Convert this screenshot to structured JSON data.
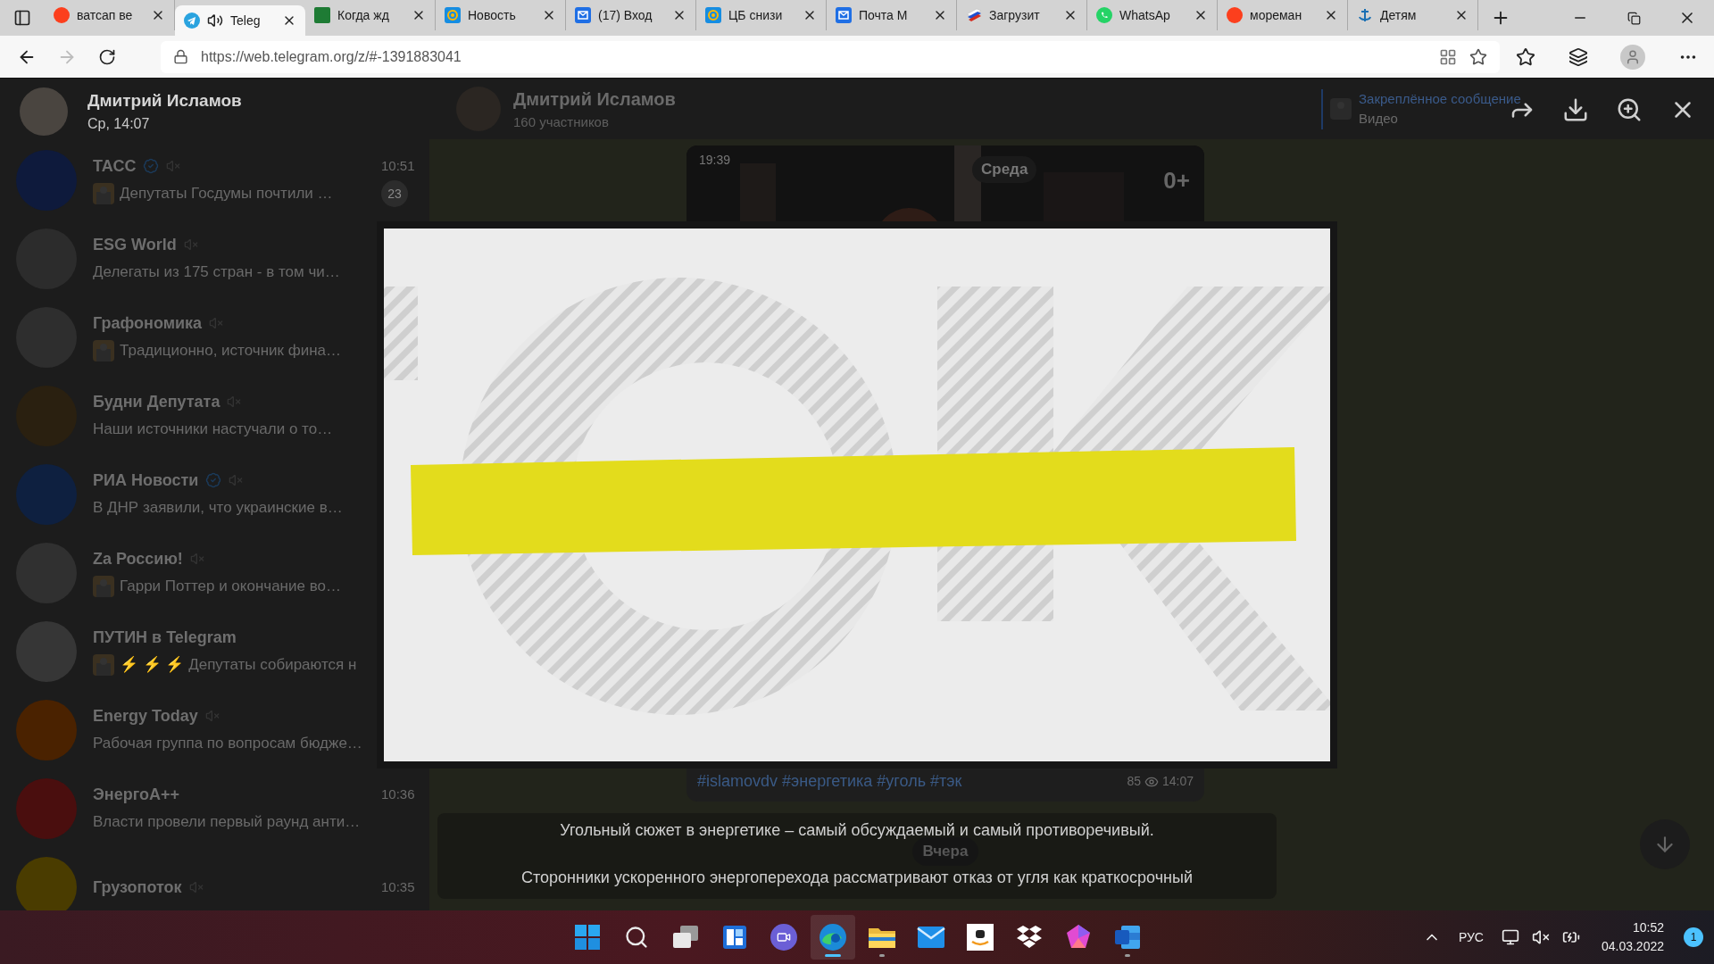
{
  "browser": {
    "tabs": [
      {
        "title": "ватсап ве",
        "kind": "yandex",
        "selected": false,
        "playing": false
      },
      {
        "title": "Teleg",
        "kind": "telegram",
        "selected": true,
        "playing": true
      },
      {
        "title": "Когда жд",
        "kind": "green",
        "selected": false,
        "playing": false
      },
      {
        "title": "Новость",
        "kind": "at",
        "selected": false,
        "playing": false
      },
      {
        "title": "(17) Вход",
        "kind": "mail",
        "selected": false,
        "playing": false
      },
      {
        "title": "ЦБ снизи",
        "kind": "at",
        "selected": false,
        "playing": false
      },
      {
        "title": "Почта М",
        "kind": "mail",
        "selected": false,
        "playing": false
      },
      {
        "title": "Загрузит",
        "kind": "flag",
        "selected": false,
        "playing": false
      },
      {
        "title": "WhatsAp",
        "kind": "whatsapp",
        "selected": false,
        "playing": false
      },
      {
        "title": "мореман",
        "kind": "yandex",
        "selected": false,
        "playing": false
      },
      {
        "title": "Детям",
        "kind": "anchor",
        "selected": false,
        "playing": false
      }
    ],
    "address": "https://web.telegram.org/z/#-1391883041"
  },
  "viewer": {
    "author": "Дмитрий Исламов",
    "date": "Ср, 14:07",
    "caption": [
      "Угольный сюжет в энергетике – самый обсуждаемый и самый противоречивый.",
      "Сторонники ускоренного энергоперехода рассматривают отказ от угля как краткосрочный"
    ]
  },
  "sidebar": {
    "chats": [
      {
        "name": "ТАСС",
        "verified": true,
        "muted": true,
        "time": "10:51",
        "preview": "Депутаты Госдумы почтили …",
        "thumbnail": true,
        "unread": "23",
        "color": "#0e1a3c"
      },
      {
        "name": "ESG World",
        "verified": false,
        "muted": true,
        "preview": "Делегаты из 175 стран - в том чи…",
        "thumbnail": false,
        "color": "#2c2c2c"
      },
      {
        "name": "Графономика",
        "verified": false,
        "muted": true,
        "preview": "Традиционно, источник фина…",
        "thumbnail": true,
        "color": "#2e2e2e"
      },
      {
        "name": "Будни Депутата",
        "verified": false,
        "muted": true,
        "preview": "Наши источники настучали о то…",
        "thumbnail": false,
        "color": "#2a2010"
      },
      {
        "name": "РИА Новости",
        "verified": true,
        "muted": true,
        "preview": "В ДНР заявили, что украинские в…",
        "thumbnail": false,
        "color": "#0e2040"
      },
      {
        "name": "Za Россию!",
        "verified": false,
        "muted": true,
        "preview": "Гарри Поттер и окончание во…",
        "thumbnail": true,
        "color": "#303030"
      },
      {
        "name": "ПУТИН в Telegram",
        "verified": false,
        "muted": false,
        "preview": "⚡ ⚡ ⚡ Депутаты собираются н",
        "thumbnail": true,
        "color": "#363636"
      },
      {
        "name": "Energy Today",
        "verified": false,
        "muted": true,
        "preview": "Рабочая группа по вопросам бюдже…",
        "thumbnail": false,
        "color": "#4a2200"
      },
      {
        "name": "ЭнергоА++",
        "verified": false,
        "muted": false,
        "time": "10:36",
        "preview": "Власти провели первый раунд анти…",
        "thumbnail": false,
        "color": "#4a0e0e"
      },
      {
        "name": "Грузопоток",
        "verified": false,
        "muted": true,
        "time": "10:35",
        "thumbnail": false,
        "color": "#4a3c00"
      }
    ]
  },
  "chat": {
    "title": "Дмитрий Исламов",
    "subtitle": "160 участников",
    "pinned_label": "Закреплённое сообщение",
    "pinned_text": "Видео",
    "message": {
      "duration": "19:39",
      "date_pill": "Среда",
      "rating": "0+",
      "hashtags": "#islamovdv #энергетика #уголь #тэк",
      "views": "85",
      "time": "14:07"
    },
    "date_pill": "Вчера"
  },
  "taskbar": {
    "apps": [
      {
        "kind": "start",
        "active": false,
        "open": false
      },
      {
        "kind": "search",
        "active": false,
        "open": false
      },
      {
        "kind": "taskview",
        "active": false,
        "open": false
      },
      {
        "kind": "widgets",
        "active": false,
        "open": false
      },
      {
        "kind": "chat",
        "active": false,
        "open": false
      },
      {
        "kind": "edge",
        "active": true,
        "open": true
      },
      {
        "kind": "explorer",
        "active": false,
        "open": true
      },
      {
        "kind": "mail",
        "active": false,
        "open": false
      },
      {
        "kind": "amazon",
        "active": false,
        "open": false
      },
      {
        "kind": "dropbox",
        "active": false,
        "open": false
      },
      {
        "kind": "prism",
        "active": false,
        "open": false
      },
      {
        "kind": "word",
        "active": false,
        "open": true
      }
    ],
    "language": "РУС",
    "time": "10:52",
    "date": "04.03.2022",
    "notifications": "1"
  }
}
